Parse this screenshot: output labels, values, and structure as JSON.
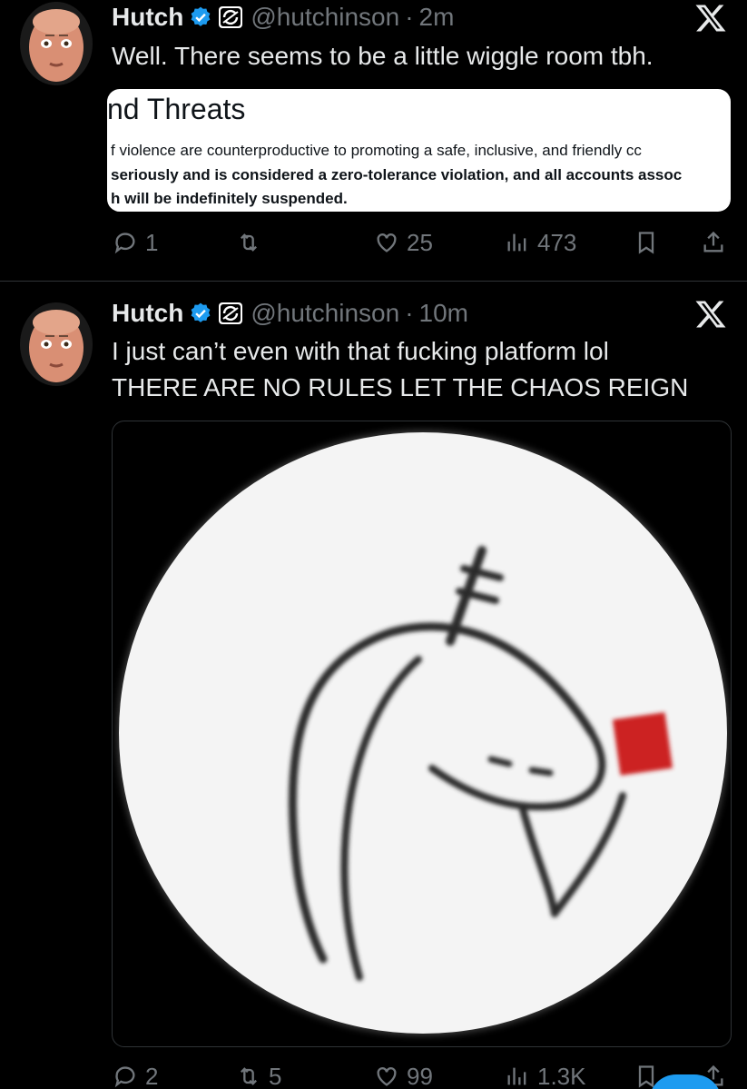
{
  "tweets": [
    {
      "name": "Hutch",
      "handle": "@hutchinson",
      "separator": "·",
      "time": "2m",
      "text": "Well. There seems to be a little wiggle room tbh.",
      "quote": {
        "title": "nd Threats",
        "line1": "f violence are counterproductive to promoting a safe, inclusive, and friendly cc",
        "line2": "seriously and is considered a zero-tolerance violation, and all accounts assoc",
        "line3": "h will be indefinitely suspended."
      },
      "actions": {
        "replies": "1",
        "reposts": "",
        "likes": "25",
        "views": "473"
      }
    },
    {
      "name": "Hutch",
      "handle": "@hutchinson",
      "separator": "·",
      "time": "10m",
      "text_line1": "I just can’t even with that fucking platform lol",
      "text_line2": "THERE ARE NO RULES LET THE CHAOS REIGN",
      "actions": {
        "replies": "2",
        "reposts": "5",
        "likes": "99",
        "views": "1.3K"
      }
    }
  ],
  "colors": {
    "background": "#000000",
    "text_primary": "#e7e9ea",
    "text_secondary": "#71767b",
    "verified_blue": "#1d9bf0",
    "divider": "#2f3336"
  },
  "icons": [
    "avatar",
    "verified-badge-icon",
    "affiliate-badge-icon",
    "x-logo-icon",
    "reply-icon",
    "repost-icon",
    "like-icon",
    "views-icon",
    "bookmark-icon",
    "share-icon"
  ]
}
